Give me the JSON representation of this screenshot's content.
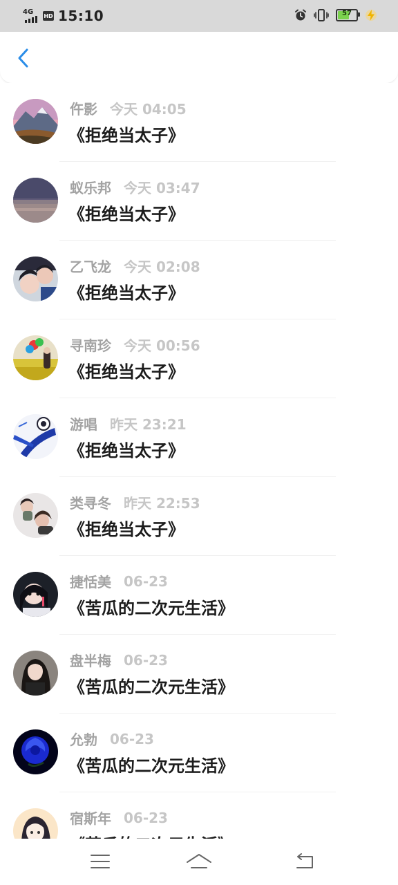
{
  "status_bar": {
    "network": "4G",
    "hd": "HD",
    "time": "15:10",
    "battery": "57",
    "battery_level": 0.57,
    "icons": [
      "alarm-icon",
      "vibrate-icon",
      "battery-icon",
      "charging-icon"
    ]
  },
  "header": {
    "back_icon": "chevron-left-icon",
    "accent_color": "#2a8de8"
  },
  "items": [
    {
      "name": "仵影",
      "time": "今天 04:05",
      "book": "《拒绝当太子》",
      "avatar": "mountain-sunset"
    },
    {
      "name": "蚁乐邦",
      "time": "今天 03:47",
      "book": "《拒绝当太子》",
      "avatar": "dusk-landscape"
    },
    {
      "name": "乙飞龙",
      "time": "今天 02:08",
      "book": "《拒绝当太子》",
      "avatar": "two-people"
    },
    {
      "name": "寻南珍",
      "time": "今天 00:56",
      "book": "《拒绝当太子》",
      "avatar": "flower-field-balloons"
    },
    {
      "name": "游唱",
      "time": "昨天 23:21",
      "book": "《拒绝当太子》",
      "avatar": "anime-blue-swirl"
    },
    {
      "name": "类寻冬",
      "time": "昨天 22:53",
      "book": "《拒绝当太子》",
      "avatar": "couple-lying"
    },
    {
      "name": "捷恬美",
      "time": "06-23",
      "book": "《苦瓜的二次元生活》",
      "avatar": "girl-dark"
    },
    {
      "name": "盘半梅",
      "time": "06-23",
      "book": "《苦瓜的二次元生活》",
      "avatar": "woman-portrait"
    },
    {
      "name": "允勃",
      "time": "06-23",
      "book": "《苦瓜的二次元生活》",
      "avatar": "blue-rose"
    },
    {
      "name": "宿斯年",
      "time": "06-23",
      "book": "《苦瓜的二次元生活》",
      "avatar": "anime-girl"
    }
  ],
  "navbar": {
    "icons": [
      "menu-icon",
      "home-icon",
      "back-icon"
    ]
  }
}
